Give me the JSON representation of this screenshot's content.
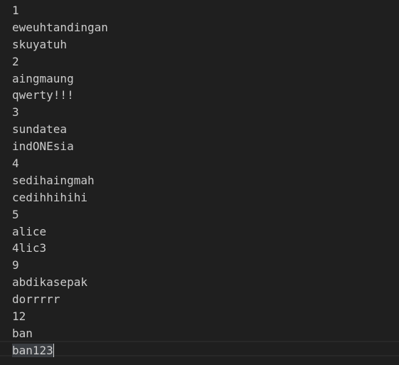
{
  "editor": {
    "lines": [
      "1",
      "eweuhtandingan",
      "skuyatuh",
      "2",
      "aingmaung",
      "qwerty!!!",
      "3",
      "sundatea",
      "indONEsia",
      "4",
      "sedihaingmah",
      "cedihhihihi",
      "5",
      "alice",
      "4lic3",
      "9",
      "abdikasepak",
      "dorrrrr",
      "12",
      "ban",
      "ban123"
    ]
  },
  "colors": {
    "background": "#1f1f1f",
    "text": "#cccccc",
    "selection": "#3a3d41",
    "current_line_border": "#282828"
  }
}
